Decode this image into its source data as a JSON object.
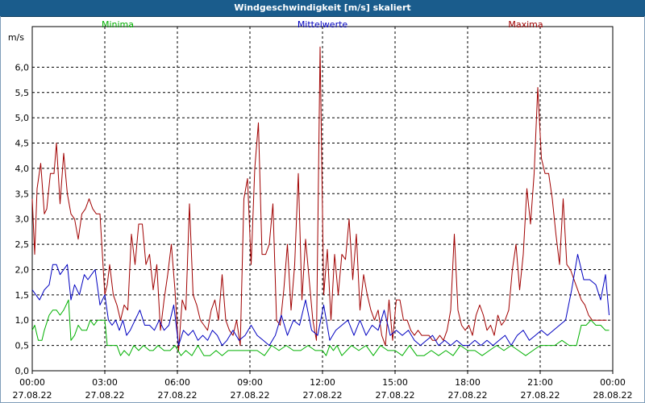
{
  "window": {
    "title": "Windgeschwindigkeit [m/s] skaliert"
  },
  "colors": {
    "titlebar": "#1a5c8c",
    "min": "#00b000",
    "mean": "#0000c0",
    "max": "#a00000",
    "grid": "#000000"
  },
  "chart_data": {
    "type": "line",
    "title": "Windgeschwindigkeit [m/s] skaliert",
    "ylabel": "m/s",
    "ylim": [
      0,
      6.5
    ],
    "y_ticks": [
      "0,0",
      "0,5",
      "1,0",
      "1,5",
      "2,0",
      "2,5",
      "3,0",
      "3,5",
      "4,0",
      "4,5",
      "5,0",
      "5,5",
      "6,0"
    ],
    "x_tick_times": [
      "00:00",
      "03:00",
      "06:00",
      "09:00",
      "12:00",
      "15:00",
      "18:00",
      "21:00",
      "00:00"
    ],
    "x_tick_dates": [
      "27.08.22",
      "27.08.22",
      "27.08.22",
      "27.08.22",
      "27.08.22",
      "27.08.22",
      "27.08.22",
      "27.08.22",
      "28.08.22"
    ],
    "xlim_hours": [
      0,
      24
    ],
    "grid": true,
    "legend_position": "top",
    "series": [
      {
        "name": "Minima",
        "color": "#00b000",
        "x_hours": [
          0,
          0.1,
          0.25,
          0.4,
          0.5,
          0.7,
          0.85,
          1,
          1.15,
          1.3,
          1.5,
          1.6,
          1.75,
          1.9,
          2.05,
          2.25,
          2.4,
          2.55,
          2.7,
          2.85,
          3,
          3.1,
          3.2,
          3.3,
          3.5,
          3.65,
          3.8,
          4,
          4.2,
          4.4,
          4.6,
          4.85,
          5,
          5.2,
          5.45,
          5.7,
          5.9,
          6.15,
          6.35,
          6.6,
          6.85,
          7.1,
          7.35,
          7.6,
          7.85,
          8.1,
          8.4,
          8.7,
          9,
          9.3,
          9.6,
          9.9,
          10.2,
          10.5,
          10.8,
          11.1,
          11.4,
          11.7,
          12,
          12.15,
          12.3,
          12.45,
          12.6,
          12.8,
          13,
          13.2,
          13.5,
          13.8,
          14.1,
          14.4,
          14.7,
          15,
          15.3,
          15.6,
          15.9,
          16.2,
          16.5,
          16.8,
          17.1,
          17.4,
          17.7,
          18,
          18.3,
          18.6,
          18.9,
          19.2,
          19.5,
          19.8,
          20.1,
          20.4,
          20.7,
          21,
          21.3,
          21.6,
          21.9,
          22.2,
          22.5,
          22.7,
          22.9,
          23.1,
          23.3,
          23.5,
          23.7,
          23.85
        ],
        "values": [
          0.8,
          0.9,
          0.6,
          0.6,
          0.8,
          1.1,
          1.2,
          1.2,
          1.1,
          1.2,
          1.4,
          0.6,
          0.7,
          0.9,
          0.8,
          0.8,
          1.0,
          0.9,
          1.0,
          1.0,
          1.0,
          0.5,
          0.5,
          0.5,
          0.5,
          0.3,
          0.4,
          0.3,
          0.5,
          0.4,
          0.5,
          0.4,
          0.4,
          0.5,
          0.4,
          0.4,
          0.5,
          0.3,
          0.4,
          0.3,
          0.5,
          0.3,
          0.3,
          0.4,
          0.3,
          0.4,
          0.4,
          0.4,
          0.4,
          0.4,
          0.3,
          0.5,
          0.4,
          0.5,
          0.4,
          0.4,
          0.5,
          0.4,
          0.4,
          0.3,
          0.5,
          0.4,
          0.5,
          0.3,
          0.4,
          0.5,
          0.4,
          0.5,
          0.3,
          0.5,
          0.4,
          0.4,
          0.3,
          0.5,
          0.3,
          0.3,
          0.4,
          0.3,
          0.4,
          0.3,
          0.5,
          0.4,
          0.4,
          0.3,
          0.4,
          0.5,
          0.4,
          0.5,
          0.4,
          0.3,
          0.4,
          0.5,
          0.5,
          0.5,
          0.6,
          0.5,
          0.5,
          0.9,
          0.9,
          1.0,
          0.9,
          0.9,
          0.8,
          0.8
        ]
      },
      {
        "name": "Mittelwerte",
        "color": "#0000c0",
        "x_hours": [
          0,
          0.15,
          0.3,
          0.5,
          0.7,
          0.85,
          1,
          1.15,
          1.3,
          1.45,
          1.6,
          1.75,
          1.95,
          2.15,
          2.3,
          2.45,
          2.6,
          2.8,
          3,
          3.15,
          3.3,
          3.45,
          3.6,
          3.75,
          3.9,
          4.05,
          4.25,
          4.45,
          4.65,
          4.85,
          5.05,
          5.25,
          5.45,
          5.65,
          5.85,
          6.05,
          6.25,
          6.45,
          6.65,
          6.85,
          7.05,
          7.25,
          7.45,
          7.65,
          7.85,
          8.05,
          8.3,
          8.55,
          8.8,
          9.05,
          9.3,
          9.55,
          9.8,
          10.05,
          10.3,
          10.55,
          10.8,
          11.05,
          11.3,
          11.55,
          11.8,
          12.05,
          12.3,
          12.55,
          12.8,
          13.05,
          13.3,
          13.55,
          13.8,
          14.05,
          14.3,
          14.55,
          14.8,
          15.05,
          15.3,
          15.55,
          15.8,
          16.05,
          16.3,
          16.55,
          16.8,
          17.05,
          17.3,
          17.55,
          17.8,
          18.05,
          18.3,
          18.55,
          18.8,
          19.05,
          19.3,
          19.55,
          19.8,
          20.05,
          20.3,
          20.55,
          20.8,
          21.05,
          21.3,
          21.55,
          21.8,
          22.05,
          22.3,
          22.55,
          22.8,
          23.05,
          23.3,
          23.5,
          23.7,
          23.85
        ],
        "values": [
          1.6,
          1.5,
          1.4,
          1.6,
          1.7,
          2.1,
          2.1,
          1.9,
          2.0,
          2.1,
          1.4,
          1.7,
          1.5,
          1.9,
          1.8,
          1.9,
          2.0,
          1.3,
          1.5,
          1.0,
          0.9,
          1.0,
          0.8,
          1.0,
          0.7,
          0.8,
          1.0,
          1.2,
          0.9,
          0.9,
          0.8,
          1.0,
          0.8,
          0.9,
          1.3,
          0.5,
          0.8,
          0.7,
          0.8,
          0.6,
          0.7,
          0.6,
          0.8,
          0.7,
          0.5,
          0.6,
          0.8,
          0.6,
          0.7,
          0.9,
          0.7,
          0.6,
          0.5,
          0.7,
          1.1,
          0.7,
          1.0,
          0.9,
          1.4,
          0.8,
          0.7,
          1.3,
          0.6,
          0.8,
          0.9,
          1.0,
          0.7,
          1.0,
          0.7,
          0.9,
          0.8,
          1.2,
          0.7,
          0.8,
          0.7,
          0.8,
          0.6,
          0.5,
          0.6,
          0.7,
          0.5,
          0.6,
          0.5,
          0.6,
          0.5,
          0.5,
          0.6,
          0.5,
          0.6,
          0.5,
          0.6,
          0.7,
          0.5,
          0.7,
          0.8,
          0.6,
          0.7,
          0.8,
          0.7,
          0.8,
          0.9,
          1.0,
          1.6,
          2.3,
          1.8,
          1.8,
          1.7,
          1.4,
          1.9,
          1.1
        ]
      },
      {
        "name": "Maxima",
        "color": "#a00000",
        "x_hours": [
          0,
          0.1,
          0.2,
          0.35,
          0.5,
          0.6,
          0.75,
          0.9,
          1,
          1.15,
          1.3,
          1.45,
          1.6,
          1.75,
          1.9,
          2.05,
          2.2,
          2.35,
          2.5,
          2.65,
          2.8,
          3,
          3.1,
          3.2,
          3.35,
          3.5,
          3.65,
          3.8,
          3.95,
          4.1,
          4.25,
          4.4,
          4.55,
          4.7,
          4.85,
          5,
          5.15,
          5.3,
          5.45,
          5.6,
          5.75,
          5.9,
          6.05,
          6.2,
          6.35,
          6.5,
          6.65,
          6.8,
          6.95,
          7.1,
          7.25,
          7.4,
          7.55,
          7.7,
          7.85,
          8,
          8.15,
          8.3,
          8.45,
          8.6,
          8.75,
          8.9,
          9.05,
          9.2,
          9.35,
          9.5,
          9.65,
          9.8,
          9.95,
          10.1,
          10.25,
          10.4,
          10.55,
          10.7,
          10.85,
          11,
          11.15,
          11.3,
          11.45,
          11.6,
          11.75,
          11.9,
          12.05,
          12.2,
          12.35,
          12.5,
          12.65,
          12.8,
          12.95,
          13.1,
          13.25,
          13.4,
          13.55,
          13.7,
          13.85,
          14,
          14.15,
          14.3,
          14.45,
          14.6,
          14.75,
          14.9,
          15.05,
          15.2,
          15.35,
          15.5,
          15.65,
          15.8,
          15.95,
          16.1,
          16.25,
          16.4,
          16.55,
          16.7,
          16.85,
          17,
          17.15,
          17.3,
          17.45,
          17.6,
          17.75,
          17.9,
          18.05,
          18.2,
          18.35,
          18.5,
          18.65,
          18.8,
          18.95,
          19.1,
          19.25,
          19.4,
          19.55,
          19.7,
          19.85,
          20,
          20.15,
          20.3,
          20.45,
          20.6,
          20.75,
          20.9,
          21.05,
          21.2,
          21.35,
          21.5,
          21.65,
          21.8,
          21.95,
          22.1,
          22.25,
          22.4,
          22.55,
          22.7,
          22.85,
          23,
          23.15,
          23.3,
          23.45,
          23.6,
          23.75,
          23.85
        ],
        "values": [
          3.4,
          2.3,
          3.6,
          4.1,
          3.1,
          3.2,
          3.9,
          3.9,
          4.5,
          3.3,
          4.3,
          3.5,
          3.1,
          3.0,
          2.6,
          3.1,
          3.2,
          3.4,
          3.2,
          3.1,
          3.1,
          1.5,
          1.7,
          2.1,
          1.5,
          1.3,
          1.0,
          1.3,
          1.2,
          2.7,
          2.1,
          2.9,
          2.9,
          2.1,
          2.3,
          1.6,
          2.1,
          0.8,
          1.4,
          1.9,
          2.5,
          1.6,
          0.4,
          1.4,
          1.2,
          3.3,
          1.5,
          1.3,
          1.0,
          0.9,
          0.8,
          1.2,
          1.4,
          1.0,
          1.9,
          1.0,
          0.8,
          0.7,
          1.0,
          0.5,
          3.4,
          3.8,
          2.1,
          4.0,
          4.9,
          2.3,
          2.3,
          2.5,
          3.3,
          1.0,
          0.9,
          1.6,
          2.5,
          1.2,
          2.1,
          3.9,
          1.4,
          2.6,
          1.8,
          1.0,
          0.6,
          6.4,
          1.5,
          2.4,
          1.0,
          2.3,
          1.5,
          2.3,
          2.2,
          3.0,
          1.8,
          2.7,
          1.2,
          1.9,
          1.5,
          1.2,
          1.0,
          1.2,
          0.7,
          0.5,
          1.4,
          0.6,
          1.4,
          1.4,
          1.0,
          1.0,
          0.8,
          0.7,
          0.8,
          0.7,
          0.7,
          0.7,
          0.6,
          0.6,
          0.7,
          0.6,
          0.8,
          1.2,
          2.7,
          1.2,
          0.9,
          0.8,
          0.9,
          0.7,
          1.1,
          1.3,
          1.1,
          0.8,
          0.9,
          0.7,
          1.1,
          0.9,
          1.0,
          1.2,
          2.0,
          2.5,
          1.6,
          2.3,
          3.6,
          2.9,
          3.9,
          5.6,
          4.2,
          3.9,
          3.9,
          3.4,
          2.7,
          2.1,
          3.4,
          2.1,
          2.0,
          1.8,
          1.6,
          1.4,
          1.3,
          1.1,
          1.0,
          1.0,
          1.0,
          1.0,
          1.0
        ]
      }
    ]
  }
}
